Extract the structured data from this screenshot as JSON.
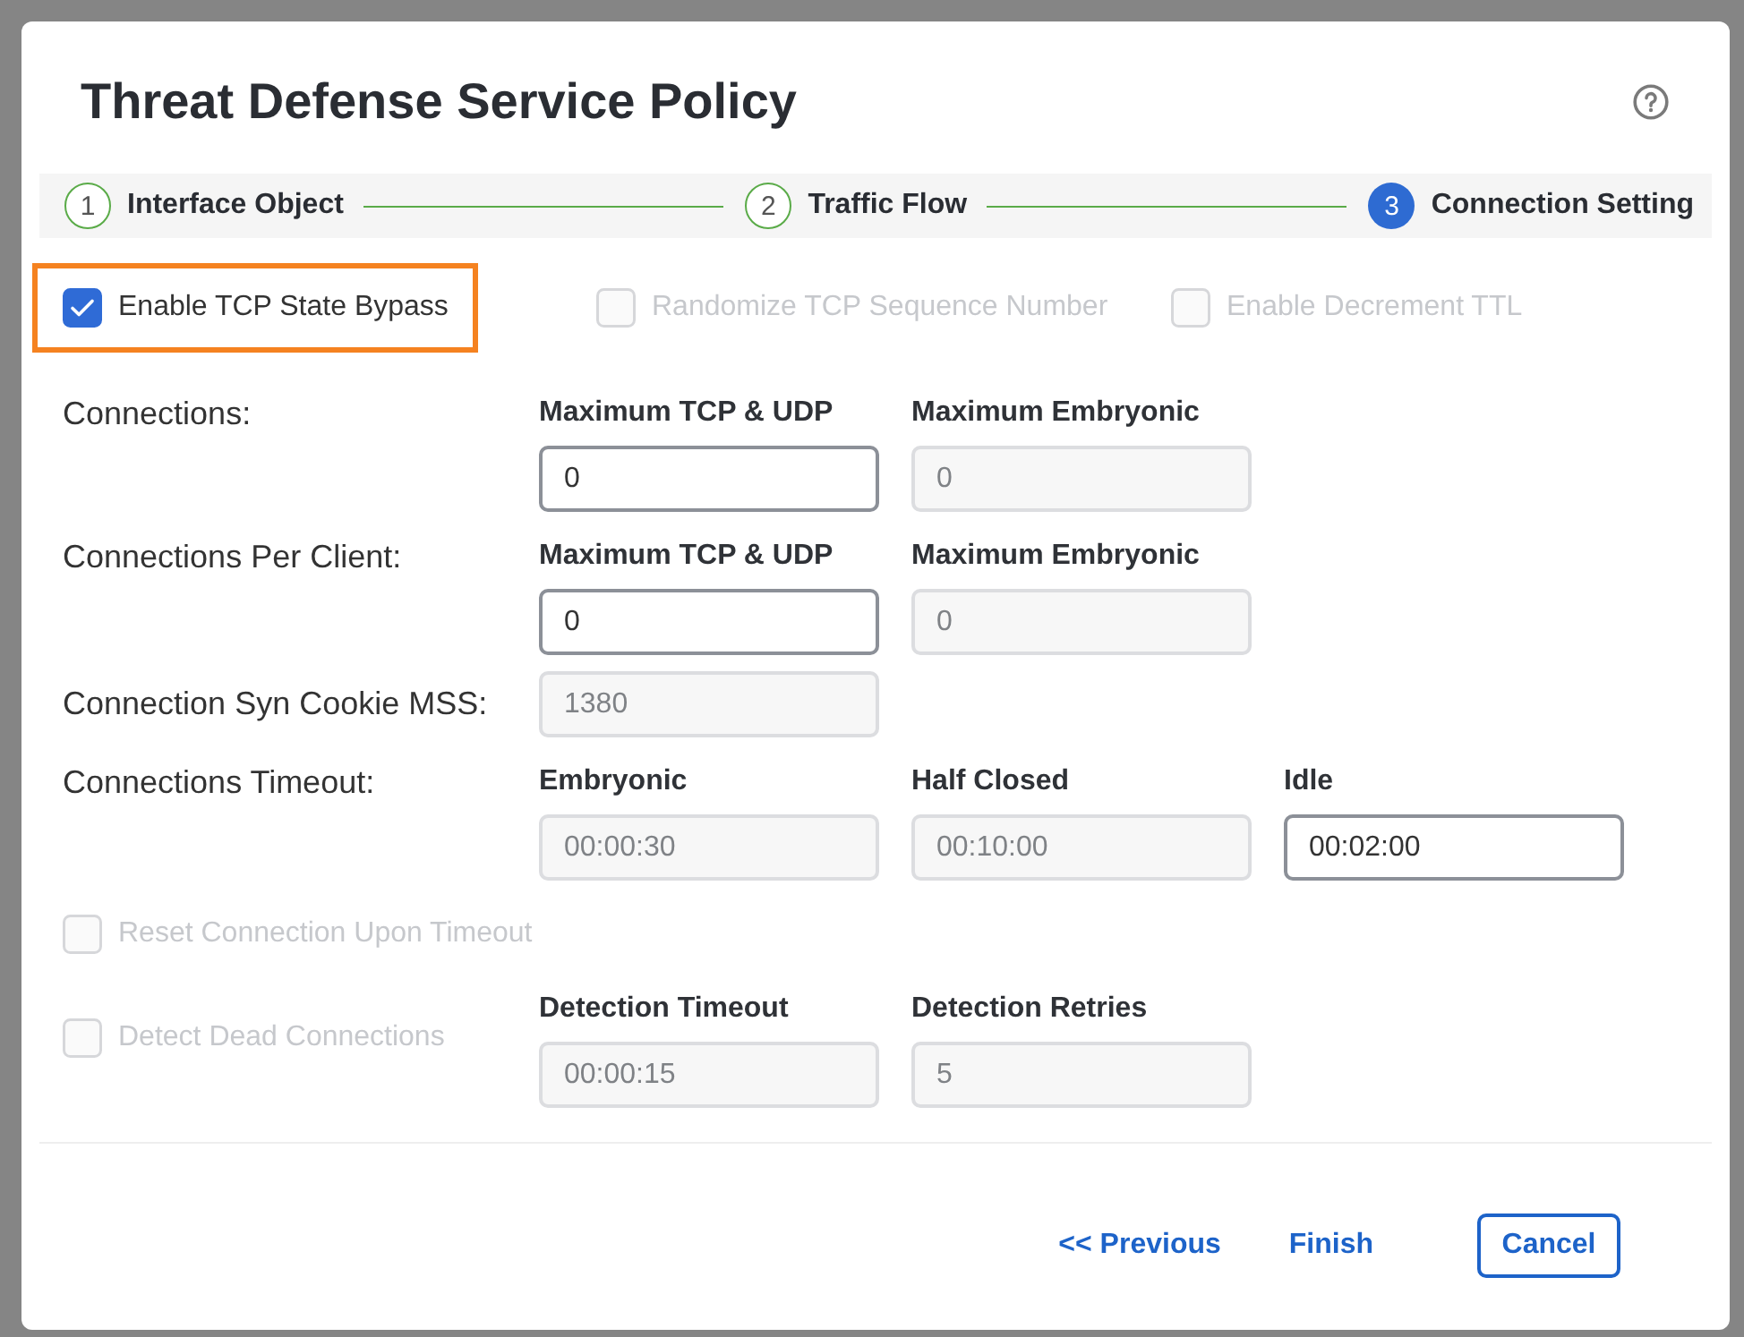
{
  "dialog": {
    "title": "Threat Defense Service Policy"
  },
  "steps": [
    {
      "number": "1",
      "label": "Interface Object",
      "completed": true,
      "selected": false
    },
    {
      "number": "2",
      "label": "Traffic Flow",
      "completed": true,
      "selected": false
    },
    {
      "number": "3",
      "label": "Connection Setting",
      "completed": false,
      "selected": true
    }
  ],
  "options": [
    {
      "label": "Enable TCP State Bypass",
      "checked": true,
      "disabled": false,
      "highlighted": true
    },
    {
      "label": "Randomize TCP Sequence Number",
      "checked": false,
      "disabled": true,
      "highlighted": false
    },
    {
      "label": "Enable Decrement TTL",
      "checked": false,
      "disabled": true,
      "highlighted": false
    }
  ],
  "rows": [
    {
      "kind": "fields",
      "label": "Connections:",
      "fields": [
        {
          "label": "Maximum TCP & UDP",
          "value": "0",
          "disabled": false
        },
        {
          "label": "Maximum Embryonic",
          "value": "0",
          "disabled": true
        }
      ]
    },
    {
      "kind": "fields",
      "label": "Connections Per Client:",
      "fields": [
        {
          "label": "Maximum TCP & UDP",
          "value": "0",
          "disabled": false
        },
        {
          "label": "Maximum Embryonic",
          "value": "0",
          "disabled": true
        }
      ]
    },
    {
      "kind": "fields",
      "label": "Connection Syn Cookie MSS:",
      "fields": [
        {
          "value": "1380",
          "disabled": true
        }
      ]
    },
    {
      "kind": "fields",
      "label": "Connections Timeout:",
      "fields": [
        {
          "label": "Embryonic",
          "value": "00:00:30",
          "disabled": true
        },
        {
          "label": "Half Closed",
          "value": "00:10:00",
          "disabled": true
        },
        {
          "label": "Idle",
          "value": "00:02:00",
          "disabled": false
        }
      ]
    },
    {
      "kind": "checkbox",
      "label": "Reset Connection Upon Timeout",
      "checked": false,
      "disabled": true
    },
    {
      "kind": "checkbox",
      "label": "Detect Dead Connections",
      "checked": false,
      "disabled": true,
      "fields": [
        {
          "label": "Detection Timeout",
          "value": "00:00:15",
          "disabled": true
        },
        {
          "label": "Detection Retries",
          "value": "5",
          "disabled": true
        }
      ]
    }
  ],
  "footer": {
    "previous": "<< Previous",
    "finish": "Finish",
    "cancel": "Cancel"
  }
}
